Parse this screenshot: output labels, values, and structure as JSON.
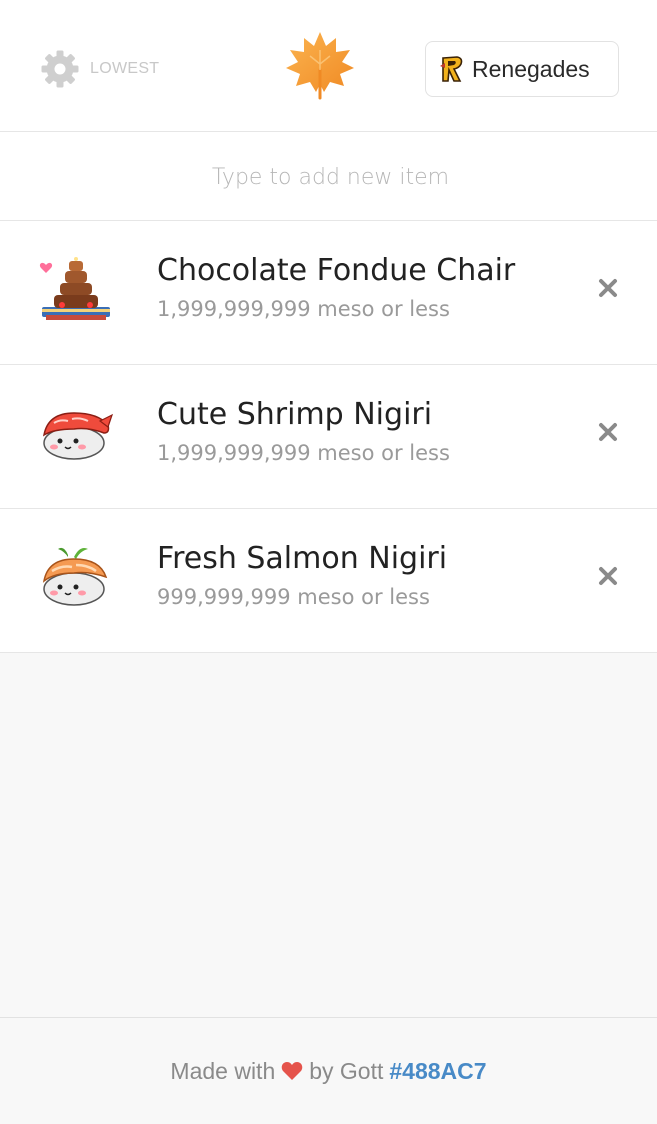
{
  "header": {
    "settings_label": "LOWEST",
    "server_label": "Renegades"
  },
  "add_item": {
    "placeholder": "Type to add new item"
  },
  "items": [
    {
      "name": "Chocolate Fondue Chair",
      "price": "1,999,999,999 meso or less",
      "icon": "chocolate-fondue-chair-icon"
    },
    {
      "name": "Cute Shrimp Nigiri",
      "price": "1,999,999,999 meso or less",
      "icon": "shrimp-nigiri-icon"
    },
    {
      "name": "Fresh Salmon Nigiri",
      "price": "999,999,999 meso or less",
      "icon": "salmon-nigiri-icon"
    }
  ],
  "footer": {
    "made_with": "Made with",
    "by": "by Gott",
    "tag": "#488AC7"
  },
  "colors": {
    "accent": "#488AC7",
    "heart": "#e5534b",
    "logo": "#f7a23a"
  }
}
